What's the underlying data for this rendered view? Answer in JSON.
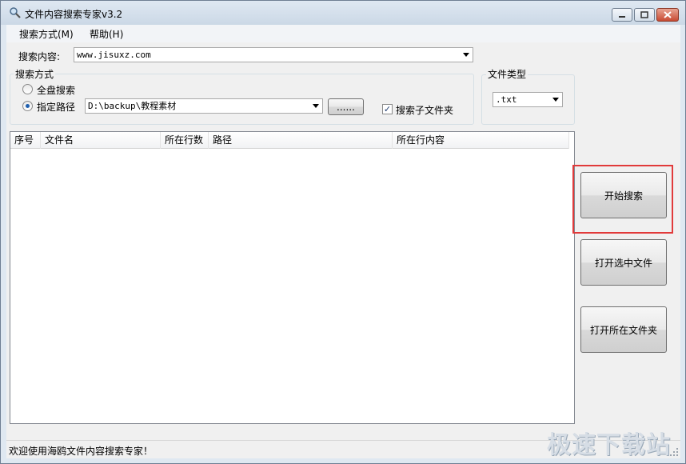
{
  "window": {
    "title": "文件内容搜索专家v3.2",
    "icon": "magnifier-icon"
  },
  "menu": {
    "search_mode": "搜索方式(M)",
    "help": "帮助(H)"
  },
  "search": {
    "label": "搜索内容:",
    "value": "www.jisuxz.com"
  },
  "search_mode_group": {
    "title": "搜索方式",
    "option_all": "全盘搜索",
    "option_path": "指定路径",
    "selected": "指定路径",
    "path_value": "D:\\backup\\教程素材",
    "browse_label": "......",
    "subfolders_label": "搜索子文件夹",
    "subfolders_checked": true
  },
  "file_type_group": {
    "title": "文件类型",
    "value": ".txt"
  },
  "results_table": {
    "columns": [
      "序号",
      "文件名",
      "所在行数",
      "路径",
      "所在行内容"
    ],
    "rows": []
  },
  "actions": {
    "start_search": "开始搜索",
    "open_selected": "打开选中文件",
    "open_folder": "打开所在文件夹"
  },
  "status": {
    "text": "欢迎使用海鸥文件内容搜索专家！"
  },
  "watermark": "极速下载站",
  "colors": {
    "highlight": "#e13a3a",
    "radio_dot": "#1e5fae"
  }
}
